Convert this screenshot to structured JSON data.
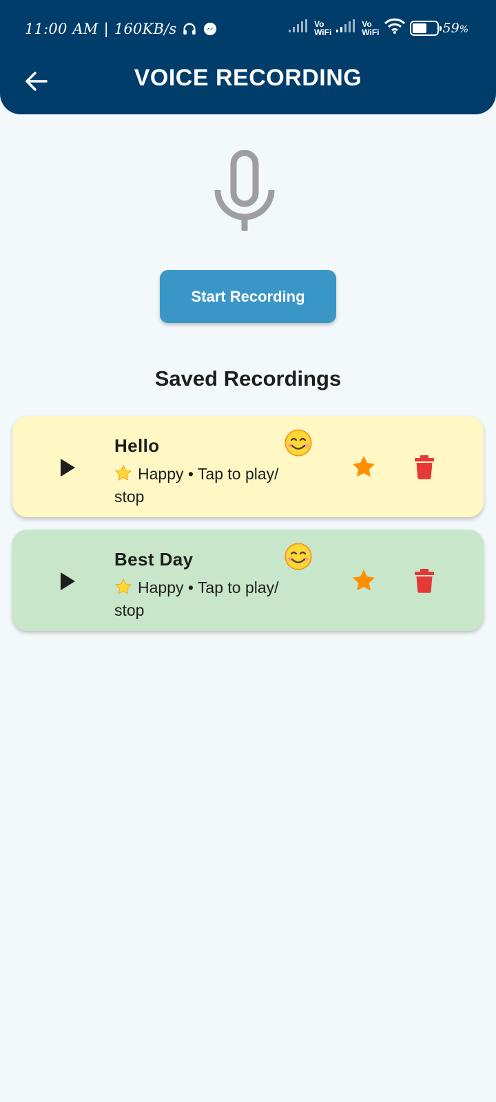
{
  "status_bar": {
    "time": "11:00",
    "ampm": "AM",
    "speed": "160KB/s",
    "vo_label": "Vo",
    "wifi_label": "WiFi",
    "battery_percent": "59",
    "battery_suffix": "%",
    "battery_level": 0.59
  },
  "header": {
    "title": "VOICE RECORDING",
    "back_icon": "arrow-left-icon",
    "background": "#003d6b"
  },
  "recorder": {
    "mic_icon": "microphone-icon",
    "button_label": "Start Recording",
    "button_color": "#3b96c8"
  },
  "saved": {
    "section_title": "Saved Recordings",
    "items": [
      {
        "title": "Hello",
        "emoji": "smiling-face-icon",
        "mood": "Happy",
        "subtitle": "Happy • Tap to play/ stop",
        "background": "#fff8c5",
        "favorite": true
      },
      {
        "title": "Best Day",
        "emoji": "smiling-face-icon",
        "mood": "Happy",
        "subtitle": "Happy • Tap to play/ stop",
        "background": "#c8e6c9",
        "favorite": true
      }
    ]
  },
  "colors": {
    "star": "#ff8f00",
    "delete": "#e53935",
    "page_background": "#f3f8fb"
  }
}
